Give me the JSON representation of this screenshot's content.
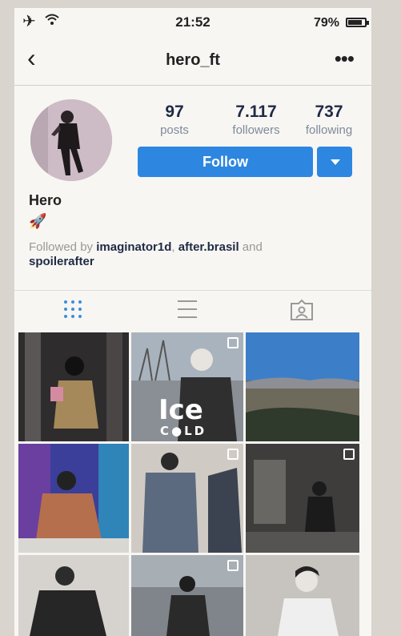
{
  "status_bar": {
    "time": "21:52",
    "battery": "79%"
  },
  "nav": {
    "back_icon": "chevron-left-icon",
    "username": "hero_ft",
    "more": "•••"
  },
  "profile": {
    "stats": [
      {
        "value": "97",
        "label": "posts"
      },
      {
        "value": "7.117",
        "label": "followers"
      },
      {
        "value": "737",
        "label": "following"
      }
    ],
    "follow_label": "Follow",
    "display_name": "Hero",
    "bio_emoji": "🚀",
    "followed_by_prefix": "Followed by",
    "followed_by_users": [
      "imaginator1d",
      "after.brasil"
    ],
    "followed_by_and": "and",
    "followed_by_last": "spoilerafter"
  },
  "tabs": [
    "grid-icon",
    "list-icon",
    "tagged-icon"
  ],
  "posts": {
    "ice_cold_line1": "Ice",
    "ice_cold_line2": "C●LD"
  },
  "colors": {
    "follow_blue": "#2d86e0",
    "text_dark": "#1f2a44",
    "muted": "#7f8a99"
  }
}
